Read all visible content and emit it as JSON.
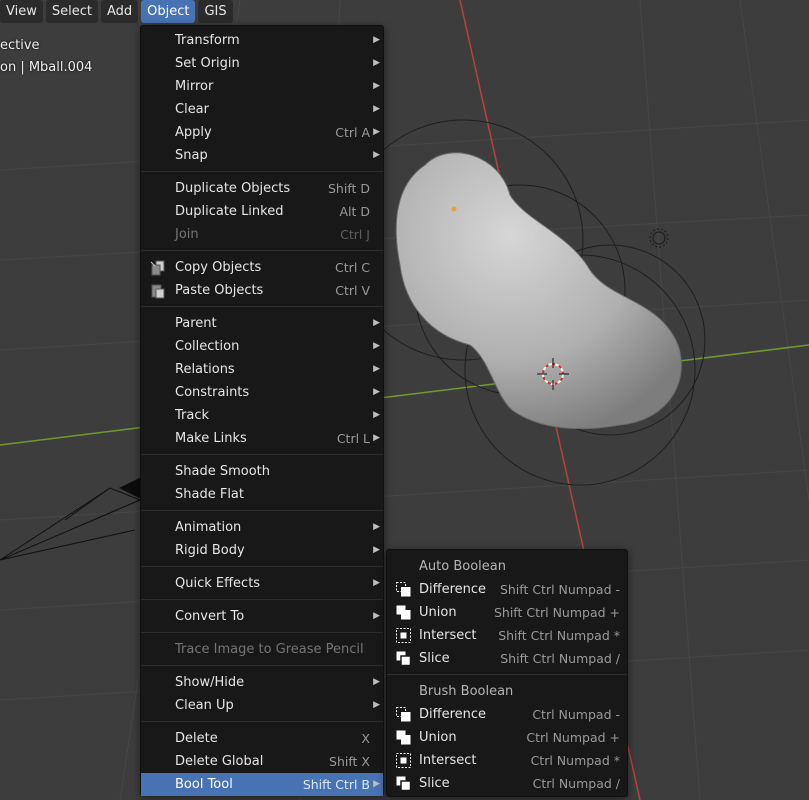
{
  "header": {
    "menus": [
      "View",
      "Select",
      "Add",
      "Object",
      "GIS"
    ],
    "active_menu": "Object"
  },
  "viewport": {
    "view_label": "ective",
    "object_label": "on | Mball.004"
  },
  "object_menu": {
    "groups": [
      [
        {
          "label": "Transform",
          "submenu": true
        },
        {
          "label": "Set Origin",
          "submenu": true
        },
        {
          "label": "Mirror",
          "submenu": true
        },
        {
          "label": "Clear",
          "submenu": true
        },
        {
          "label": "Apply",
          "shortcut": "Ctrl A",
          "submenu": true
        },
        {
          "label": "Snap",
          "submenu": true
        }
      ],
      [
        {
          "label": "Duplicate Objects",
          "shortcut": "Shift D"
        },
        {
          "label": "Duplicate Linked",
          "shortcut": "Alt D"
        },
        {
          "label": "Join",
          "shortcut": "Ctrl J",
          "disabled": true
        }
      ],
      [
        {
          "label": "Copy Objects",
          "shortcut": "Ctrl C",
          "icon": "copy-icon"
        },
        {
          "label": "Paste Objects",
          "shortcut": "Ctrl V",
          "icon": "paste-icon"
        }
      ],
      [
        {
          "label": "Parent",
          "submenu": true
        },
        {
          "label": "Collection",
          "submenu": true
        },
        {
          "label": "Relations",
          "submenu": true
        },
        {
          "label": "Constraints",
          "submenu": true
        },
        {
          "label": "Track",
          "submenu": true
        },
        {
          "label": "Make Links",
          "shortcut": "Ctrl L",
          "submenu": true
        }
      ],
      [
        {
          "label": "Shade Smooth"
        },
        {
          "label": "Shade Flat"
        }
      ],
      [
        {
          "label": "Animation",
          "submenu": true
        },
        {
          "label": "Rigid Body",
          "submenu": true
        }
      ],
      [
        {
          "label": "Quick Effects",
          "submenu": true
        }
      ],
      [
        {
          "label": "Convert To",
          "submenu": true
        }
      ],
      [
        {
          "label": "Trace Image to Grease Pencil",
          "disabled": true
        }
      ],
      [
        {
          "label": "Show/Hide",
          "submenu": true
        },
        {
          "label": "Clean Up",
          "submenu": true
        }
      ],
      [
        {
          "label": "Delete",
          "shortcut": "X"
        },
        {
          "label": "Delete Global",
          "shortcut": "Shift X"
        },
        {
          "label": "Bool Tool",
          "shortcut": "Shift Ctrl B",
          "submenu": true,
          "highlight": true
        }
      ]
    ]
  },
  "bool_tool_menu": {
    "sections": [
      {
        "heading": "Auto Boolean",
        "items": [
          {
            "label": "Difference",
            "shortcut": "Shift Ctrl Numpad -",
            "icon": "difference-icon"
          },
          {
            "label": "Union",
            "shortcut": "Shift Ctrl Numpad +",
            "icon": "union-icon"
          },
          {
            "label": "Intersect",
            "shortcut": "Shift Ctrl Numpad *",
            "icon": "intersect-icon"
          },
          {
            "label": "Slice",
            "shortcut": "Shift Ctrl Numpad /",
            "icon": "slice-icon"
          }
        ]
      },
      {
        "heading": "Brush Boolean",
        "items": [
          {
            "label": "Difference",
            "shortcut": "Ctrl Numpad -",
            "icon": "difference-icon"
          },
          {
            "label": "Union",
            "shortcut": "Ctrl Numpad +",
            "icon": "union-icon"
          },
          {
            "label": "Intersect",
            "shortcut": "Ctrl Numpad *",
            "icon": "intersect-icon"
          },
          {
            "label": "Slice",
            "shortcut": "Ctrl Numpad /",
            "icon": "slice-icon"
          }
        ]
      }
    ]
  },
  "colors": {
    "menu_bg": "#181818",
    "highlight": "#4772b3",
    "viewport_bg": "#3d3d3d",
    "x_axis": "#c0392b",
    "y_axis": "#6a9a2a"
  }
}
